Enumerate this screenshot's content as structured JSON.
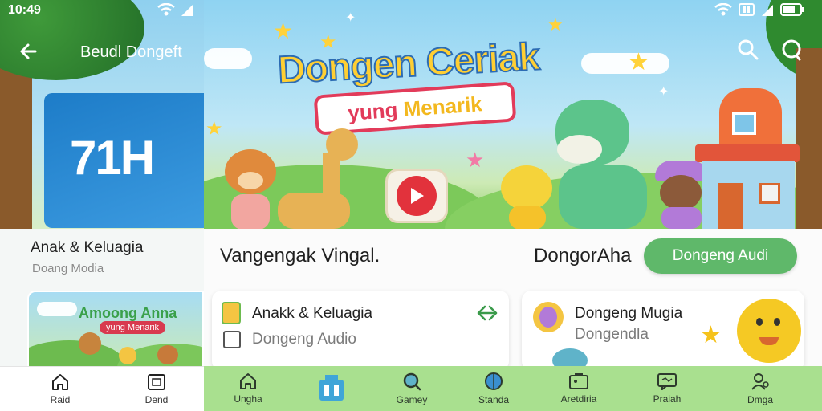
{
  "left_panel": {
    "status_time": "10:49",
    "topbar_title": "Beudl Dongeft",
    "tile_text": "71H",
    "category_title": "Anak & Keluagia",
    "category_subtitle": "Doang Modia",
    "thumb_title": "Amoong Anna",
    "thumb_subtitle": "yung Menarik",
    "nav": [
      {
        "label": "Raid",
        "icon": "home-icon"
      },
      {
        "label": "Dend",
        "icon": "book-icon"
      }
    ]
  },
  "main_panel": {
    "hero_title": "Dongen Ceriak",
    "hero_banner_prefix": "yung ",
    "hero_banner_highlight": "Menarik",
    "section_left_title": "Vangengak  Vingal.",
    "section_right_title": "DongorAha",
    "pill_label": "Dongeng Audi",
    "cards": [
      {
        "title": "Anakk & Keluagia",
        "subtitle": "Dongeng Audio"
      },
      {
        "title": "Dongeng Mugia",
        "subtitle": "Dongendla"
      }
    ],
    "nav": [
      {
        "label": "Ungha",
        "icon": "home-icon"
      },
      {
        "label": "",
        "icon": "library-icon"
      },
      {
        "label": "Gamey",
        "icon": "search-icon"
      },
      {
        "label": "Standa",
        "icon": "globe-icon"
      },
      {
        "label": "Aretdiria",
        "icon": "gallery-icon"
      },
      {
        "label": "Praiah",
        "icon": "chat-icon"
      },
      {
        "label": "Dmga",
        "icon": "profile-icon"
      }
    ]
  },
  "colors": {
    "accent_green": "#5fb86a",
    "nav_green": "#a9e08f",
    "play_red": "#e2323c"
  }
}
